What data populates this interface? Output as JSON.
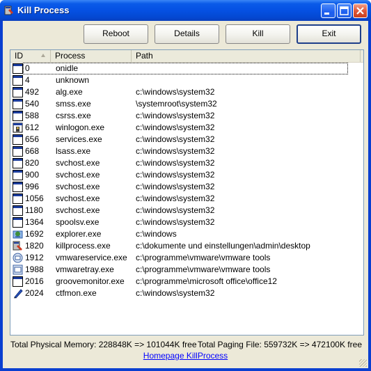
{
  "window": {
    "title": "Kill Process"
  },
  "toolbar": {
    "reboot": "Reboot",
    "details": "Details",
    "kill": "Kill",
    "exit": "Exit"
  },
  "list": {
    "columns": [
      "ID",
      "Process",
      "Path"
    ],
    "rows": [
      {
        "id": "0",
        "process": "onidle",
        "path": "",
        "icon": "window-icon"
      },
      {
        "id": "4",
        "process": "unknown",
        "path": "",
        "icon": "window-icon"
      },
      {
        "id": "492",
        "process": "alg.exe",
        "path": "c:\\windows\\system32",
        "icon": "window-icon"
      },
      {
        "id": "540",
        "process": "smss.exe",
        "path": "\\systemroot\\system32",
        "icon": "window-icon"
      },
      {
        "id": "588",
        "process": "csrss.exe",
        "path": "c:\\windows\\system32",
        "icon": "window-icon"
      },
      {
        "id": "612",
        "process": "winlogon.exe",
        "path": "c:\\windows\\system32",
        "icon": "winlogon-icon"
      },
      {
        "id": "656",
        "process": "services.exe",
        "path": "c:\\windows\\system32",
        "icon": "window-icon"
      },
      {
        "id": "668",
        "process": "lsass.exe",
        "path": "c:\\windows\\system32",
        "icon": "window-icon"
      },
      {
        "id": "820",
        "process": "svchost.exe",
        "path": "c:\\windows\\system32",
        "icon": "window-icon"
      },
      {
        "id": "900",
        "process": "svchost.exe",
        "path": "c:\\windows\\system32",
        "icon": "window-icon"
      },
      {
        "id": "996",
        "process": "svchost.exe",
        "path": "c:\\windows\\system32",
        "icon": "window-icon"
      },
      {
        "id": "1056",
        "process": "svchost.exe",
        "path": "c:\\windows\\system32",
        "icon": "window-icon"
      },
      {
        "id": "1180",
        "process": "svchost.exe",
        "path": "c:\\windows\\system32",
        "icon": "window-icon"
      },
      {
        "id": "1364",
        "process": "spoolsv.exe",
        "path": "c:\\windows\\system32",
        "icon": "window-icon"
      },
      {
        "id": "1692",
        "process": "explorer.exe",
        "path": "c:\\windows",
        "icon": "explorer-icon"
      },
      {
        "id": "1820",
        "process": "killprocess.exe",
        "path": "c:\\dokumente und einstellungen\\admin\\desktop",
        "icon": "killprocess-icon"
      },
      {
        "id": "1912",
        "process": "vmwareservice.exe",
        "path": "c:\\programme\\vmware\\vmware tools",
        "icon": "vmware-service-icon"
      },
      {
        "id": "1988",
        "process": "vmwaretray.exe",
        "path": "c:\\programme\\vmware\\vmware tools",
        "icon": "vmware-tray-icon"
      },
      {
        "id": "2016",
        "process": "groovemonitor.exe",
        "path": "c:\\programme\\microsoft office\\office12",
        "icon": "window-icon"
      },
      {
        "id": "2024",
        "process": "ctfmon.exe",
        "path": "c:\\windows\\system32",
        "icon": "ctfmon-icon"
      }
    ]
  },
  "footer": {
    "physical_memory": "Total Physical Memory: 228848K => 101044K free",
    "paging_file": "Total Paging File: 559732K => 472100K free",
    "homepage_link": "Homepage KillProcess"
  }
}
